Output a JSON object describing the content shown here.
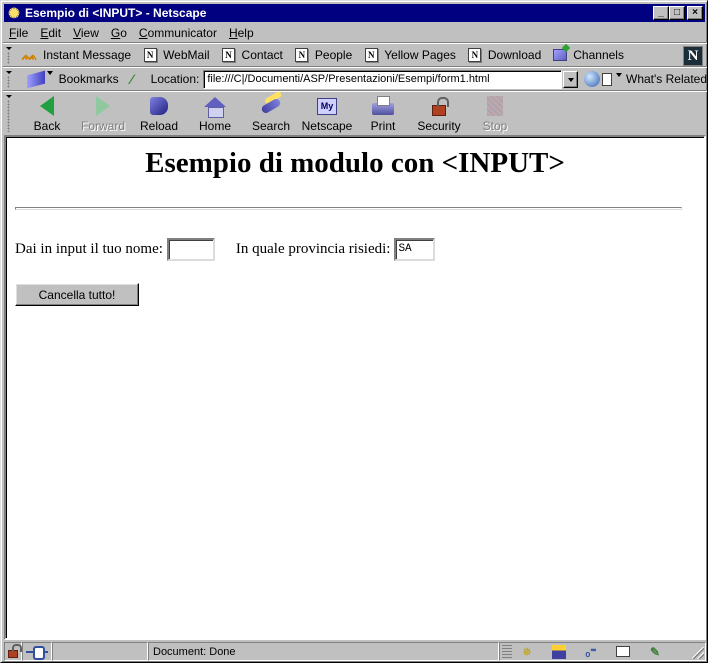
{
  "window": {
    "title": "Esempio di <INPUT> - Netscape",
    "controls": {
      "minimize": "_",
      "maximize": "□",
      "close": "×"
    }
  },
  "menubar": {
    "items": [
      {
        "label": "File",
        "accel": "F",
        "rest": "ile"
      },
      {
        "label": "Edit",
        "accel": "E",
        "rest": "dit"
      },
      {
        "label": "View",
        "accel": "V",
        "rest": "iew"
      },
      {
        "label": "Go",
        "accel": "G",
        "rest": "o"
      },
      {
        "label": "Communicator",
        "accel": "C",
        "rest": "ommunicator"
      },
      {
        "label": "Help",
        "accel": "H",
        "rest": "elp"
      }
    ]
  },
  "personal_toolbar": {
    "items": [
      {
        "label": "Instant Message",
        "icon": "instant-message-icon"
      },
      {
        "label": "WebMail",
        "icon": "netscape-bookmark-icon"
      },
      {
        "label": "Contact",
        "icon": "netscape-bookmark-icon"
      },
      {
        "label": "People",
        "icon": "netscape-bookmark-icon"
      },
      {
        "label": "Yellow Pages",
        "icon": "netscape-bookmark-icon"
      },
      {
        "label": "Download",
        "icon": "netscape-bookmark-icon"
      },
      {
        "label": "Channels",
        "icon": "channels-icon"
      }
    ],
    "logo": "N"
  },
  "location_toolbar": {
    "bookmarks_label": "Bookmarks",
    "location_label": "Location:",
    "url": "file:///C|/Documenti/ASP/Presentazioni/Esempi/form1.html",
    "whats_related_label": "What's Related"
  },
  "navigation_toolbar": {
    "buttons": [
      {
        "label": "Back",
        "enabled": true
      },
      {
        "label": "Forward",
        "enabled": false
      },
      {
        "label": "Reload",
        "enabled": true
      },
      {
        "label": "Home",
        "enabled": true
      },
      {
        "label": "Search",
        "enabled": true
      },
      {
        "label": "Netscape",
        "enabled": true
      },
      {
        "label": "Print",
        "enabled": true
      },
      {
        "label": "Security",
        "enabled": true
      },
      {
        "label": "Stop",
        "enabled": false
      }
    ],
    "my_netscape_icon_text": "My"
  },
  "page": {
    "heading": "Esempio di modulo con <INPUT>",
    "form": {
      "name_label": "Dai in input il tuo nome:",
      "name_value": "",
      "province_label": "In quale provincia risiedi:",
      "province_value": "SA",
      "reset_label": "Cancella tutto!"
    }
  },
  "statusbar": {
    "text": "Document: Done"
  }
}
